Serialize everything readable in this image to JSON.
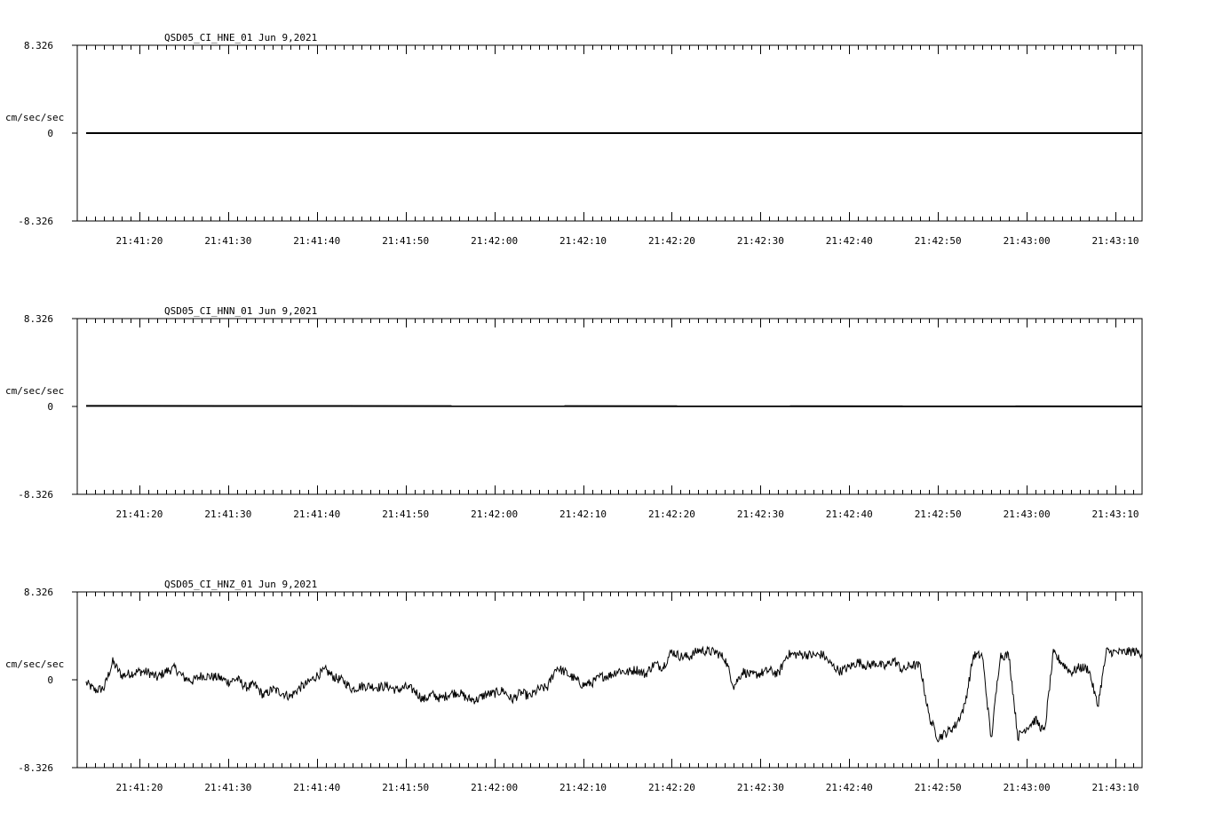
{
  "chart_data": [
    {
      "type": "line",
      "title": "QSD05_CI_HNE_01  Jun 9,2021",
      "ylabel": "cm/sec/sec",
      "ylim": [
        -8.326,
        8.326
      ],
      "ytick_labels": [
        "8.326",
        "0",
        "-8.326"
      ],
      "xlim": [
        "21:41:13",
        "21:43:13"
      ],
      "xtick_labels": [
        "21:41:20",
        "21:41:30",
        "21:41:40",
        "21:41:50",
        "21:42:00",
        "21:42:10",
        "21:42:20",
        "21:42:30",
        "21:42:40",
        "21:42:50",
        "21:43:00",
        "21:43:10"
      ],
      "trace_start": "21:41:14",
      "trace_end": "21:43:13",
      "series": [
        {
          "x": [
            "21:41:14",
            "21:41:30",
            "21:41:50",
            "21:42:10",
            "21:42:30",
            "21:42:50",
            "21:43:13"
          ],
          "values": [
            0,
            0,
            0,
            0,
            0,
            0,
            0
          ]
        }
      ]
    },
    {
      "type": "line",
      "title": "QSD05_CI_HNN_01  Jun 9,2021",
      "ylabel": "cm/sec/sec",
      "ylim": [
        -8.326,
        8.326
      ],
      "ytick_labels": [
        "8.326",
        "0",
        "-8.326"
      ],
      "xlim": [
        "21:41:13",
        "21:43:13"
      ],
      "xtick_labels": [
        "21:41:20",
        "21:41:30",
        "21:41:40",
        "21:41:50",
        "21:42:00",
        "21:42:10",
        "21:42:20",
        "21:42:30",
        "21:42:40",
        "21:42:50",
        "21:43:00",
        "21:43:10"
      ],
      "trace_start": "21:41:14",
      "trace_end": "21:43:13",
      "series": [
        {
          "x": [
            "21:41:14",
            "21:41:30",
            "21:41:50",
            "21:42:10",
            "21:42:30",
            "21:42:50",
            "21:43:13"
          ],
          "values": [
            0.05,
            0,
            0,
            0,
            0,
            0,
            0
          ]
        }
      ]
    },
    {
      "type": "line",
      "title": "QSD05_CI_HNZ_01  Jun 9,2021",
      "ylabel": "cm/sec/sec",
      "ylim": [
        -8.326,
        8.326
      ],
      "ytick_labels": [
        "8.326",
        "0",
        "-8.326"
      ],
      "xlim": [
        "21:41:13",
        "21:43:13"
      ],
      "xtick_labels": [
        "21:41:20",
        "21:41:30",
        "21:41:40",
        "21:41:50",
        "21:42:00",
        "21:42:10",
        "21:42:20",
        "21:42:30",
        "21:42:40",
        "21:42:50",
        "21:43:00",
        "21:43:10"
      ],
      "trace_start": "21:41:14",
      "trace_end": "21:43:13",
      "series": [
        {
          "x": [
            "21:41:14",
            "21:41:15",
            "21:41:16",
            "21:41:17",
            "21:41:18",
            "21:41:19",
            "21:41:20",
            "21:41:21",
            "21:41:22",
            "21:41:23",
            "21:41:24",
            "21:41:25",
            "21:41:26",
            "21:41:27",
            "21:41:28",
            "21:41:29",
            "21:41:30",
            "21:41:31",
            "21:41:32",
            "21:41:33",
            "21:41:34",
            "21:41:35",
            "21:41:36",
            "21:41:37",
            "21:41:38",
            "21:41:39",
            "21:41:40",
            "21:41:41",
            "21:41:42",
            "21:41:43",
            "21:41:44",
            "21:41:45",
            "21:41:46",
            "21:41:47",
            "21:41:48",
            "21:41:49",
            "21:41:50",
            "21:41:51",
            "21:41:52",
            "21:41:53",
            "21:41:54",
            "21:41:55",
            "21:41:56",
            "21:41:57",
            "21:41:58",
            "21:41:59",
            "21:42:00",
            "21:42:01",
            "21:42:02",
            "21:42:03",
            "21:42:04",
            "21:42:05",
            "21:42:06",
            "21:42:07",
            "21:42:08",
            "21:42:09",
            "21:42:10",
            "21:42:11",
            "21:42:12",
            "21:42:13",
            "21:42:14",
            "21:42:15",
            "21:42:16",
            "21:42:17",
            "21:42:18",
            "21:42:19",
            "21:42:20",
            "21:42:21",
            "21:42:22",
            "21:42:23",
            "21:42:24",
            "21:42:25",
            "21:42:26",
            "21:42:27",
            "21:42:28",
            "21:42:29",
            "21:42:30",
            "21:42:31",
            "21:42:32",
            "21:42:33",
            "21:42:34",
            "21:42:35",
            "21:42:36",
            "21:42:37",
            "21:42:38",
            "21:42:39",
            "21:42:40",
            "21:42:41",
            "21:42:42",
            "21:42:43",
            "21:42:44",
            "21:42:45",
            "21:42:46",
            "21:42:47",
            "21:42:48",
            "21:42:49",
            "21:42:50",
            "21:42:51",
            "21:42:52",
            "21:42:53",
            "21:42:54",
            "21:42:55",
            "21:42:56",
            "21:42:57",
            "21:42:58",
            "21:42:59",
            "21:43:00",
            "21:43:01",
            "21:43:02",
            "21:43:03",
            "21:43:04",
            "21:43:05",
            "21:43:06",
            "21:43:07",
            "21:43:08",
            "21:43:09",
            "21:43:10",
            "21:43:11",
            "21:43:12",
            "21:43:13"
          ],
          "values": [
            -0.3,
            -1.0,
            -0.8,
            1.7,
            0.4,
            0.6,
            0.8,
            0.7,
            0.2,
            0.8,
            1.1,
            0.2,
            -0.1,
            0.4,
            0.3,
            0.2,
            -0.2,
            0.1,
            -0.7,
            -0.5,
            -1.5,
            -0.9,
            -1.2,
            -1.6,
            -0.8,
            -0.3,
            0.4,
            0.9,
            0.2,
            -0.1,
            -0.9,
            -0.6,
            -0.6,
            -0.7,
            -0.6,
            -1.0,
            -0.7,
            -1.0,
            -1.9,
            -1.4,
            -1.8,
            -1.3,
            -1.2,
            -1.8,
            -1.9,
            -1.4,
            -1.3,
            -1.0,
            -1.9,
            -1.2,
            -1.6,
            -0.9,
            -0.7,
            1.2,
            0.7,
            0.1,
            -0.5,
            -0.3,
            0.3,
            0.4,
            0.9,
            0.7,
            1.0,
            0.5,
            1.5,
            1.2,
            2.7,
            2.2,
            2.2,
            2.8,
            2.7,
            2.6,
            2.0,
            -0.6,
            0.8,
            0.4,
            0.6,
            0.9,
            0.5,
            2.4,
            2.4,
            2.4,
            2.3,
            2.4,
            1.4,
            0.8,
            1.2,
            1.7,
            1.3,
            1.6,
            1.2,
            1.9,
            0.9,
            1.4,
            1.3,
            -3.5,
            -5.5,
            -5.0,
            -4.3,
            -2.5,
            2.3,
            2.3,
            -5.7,
            2.3,
            2.3,
            -5.4,
            -4.5,
            -3.8,
            -5.0,
            2.5,
            1.6,
            0.7,
            1.2,
            1.0,
            -2.5,
            2.7,
            2.6,
            2.6,
            2.7,
            2.5
          ]
        }
      ]
    }
  ]
}
